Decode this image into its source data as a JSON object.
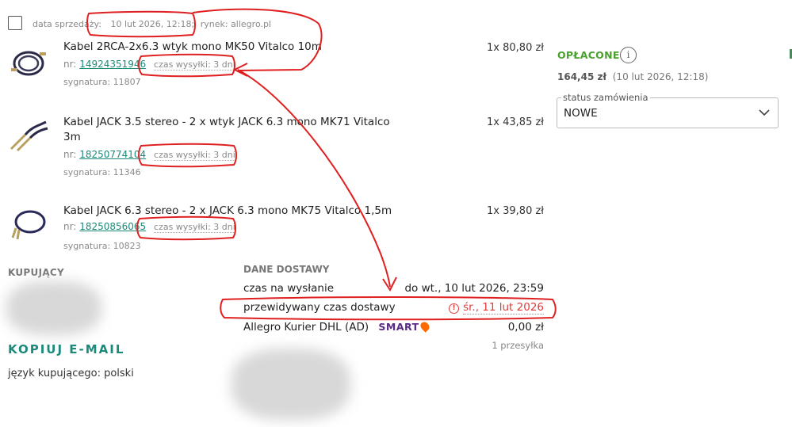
{
  "header": {
    "sale_date_label": "data sprzedaży:",
    "sale_date_value": "10 lut 2026, 12:18;",
    "market_label": "rynek:",
    "market_value": "allegro.pl"
  },
  "items": [
    {
      "title": "Kabel 2RCA-2x6.3 wtyk mono MK50 Vitalco 10m",
      "nr_label": "nr:",
      "nr": "14924351946",
      "shipping_time": "czas wysyłki: 3 dni",
      "signature": "sygnatura: 11807",
      "qty_price": "1x 80,80 zł"
    },
    {
      "title_line1": "Kabel JACK 3.5 stereo - 2 x wtyk JACK 6.3 mono MK71 Vitalco",
      "title_line2": "3m",
      "nr_label": "nr:",
      "nr": "18250774104",
      "shipping_time": "czas wysyłki: 3 dni",
      "signature": "sygnatura: 11346",
      "qty_price": "1x 43,85 zł"
    },
    {
      "title": "Kabel JACK 6.3 stereo - 2 x JACK 6.3 mono MK75 Vitalco 1,5m",
      "nr_label": "nr:",
      "nr": "18250856065",
      "shipping_time": "czas wysyłki: 3 dni",
      "signature": "sygnatura: 10823",
      "qty_price": "1x 39,80 zł"
    }
  ],
  "payment": {
    "status": "OPŁACONE",
    "info_icon": "i",
    "amount": "164,45 zł",
    "date": "(10 lut 2026, 12:18)"
  },
  "order_status": {
    "label": "status zamówienia",
    "value": "NOWE"
  },
  "buyer": {
    "heading": "KUPUJĄCY",
    "copy_email": "KOPIUJ E-MAIL",
    "language": "język kupującego: polski"
  },
  "delivery": {
    "heading": "DANE DOSTAWY",
    "rows": [
      {
        "label": "czas na wysłanie",
        "value": "do wt., 10 lut 2026, 23:59"
      },
      {
        "label": "przewidywany czas dostawy",
        "value": "śr., 11 lut 2026"
      },
      {
        "label": "Allegro Kurier DHL (AD)",
        "value": "0,00 zł"
      }
    ],
    "smart_label": "SMART",
    "parcels": "1 przesyłka"
  },
  "colors": {
    "accent_teal": "#1b8a7a",
    "paid_green": "#4aa02c",
    "warning_red": "#e03a3a",
    "annotation_red": "#e02020",
    "smart_purple": "#5b2a86"
  }
}
